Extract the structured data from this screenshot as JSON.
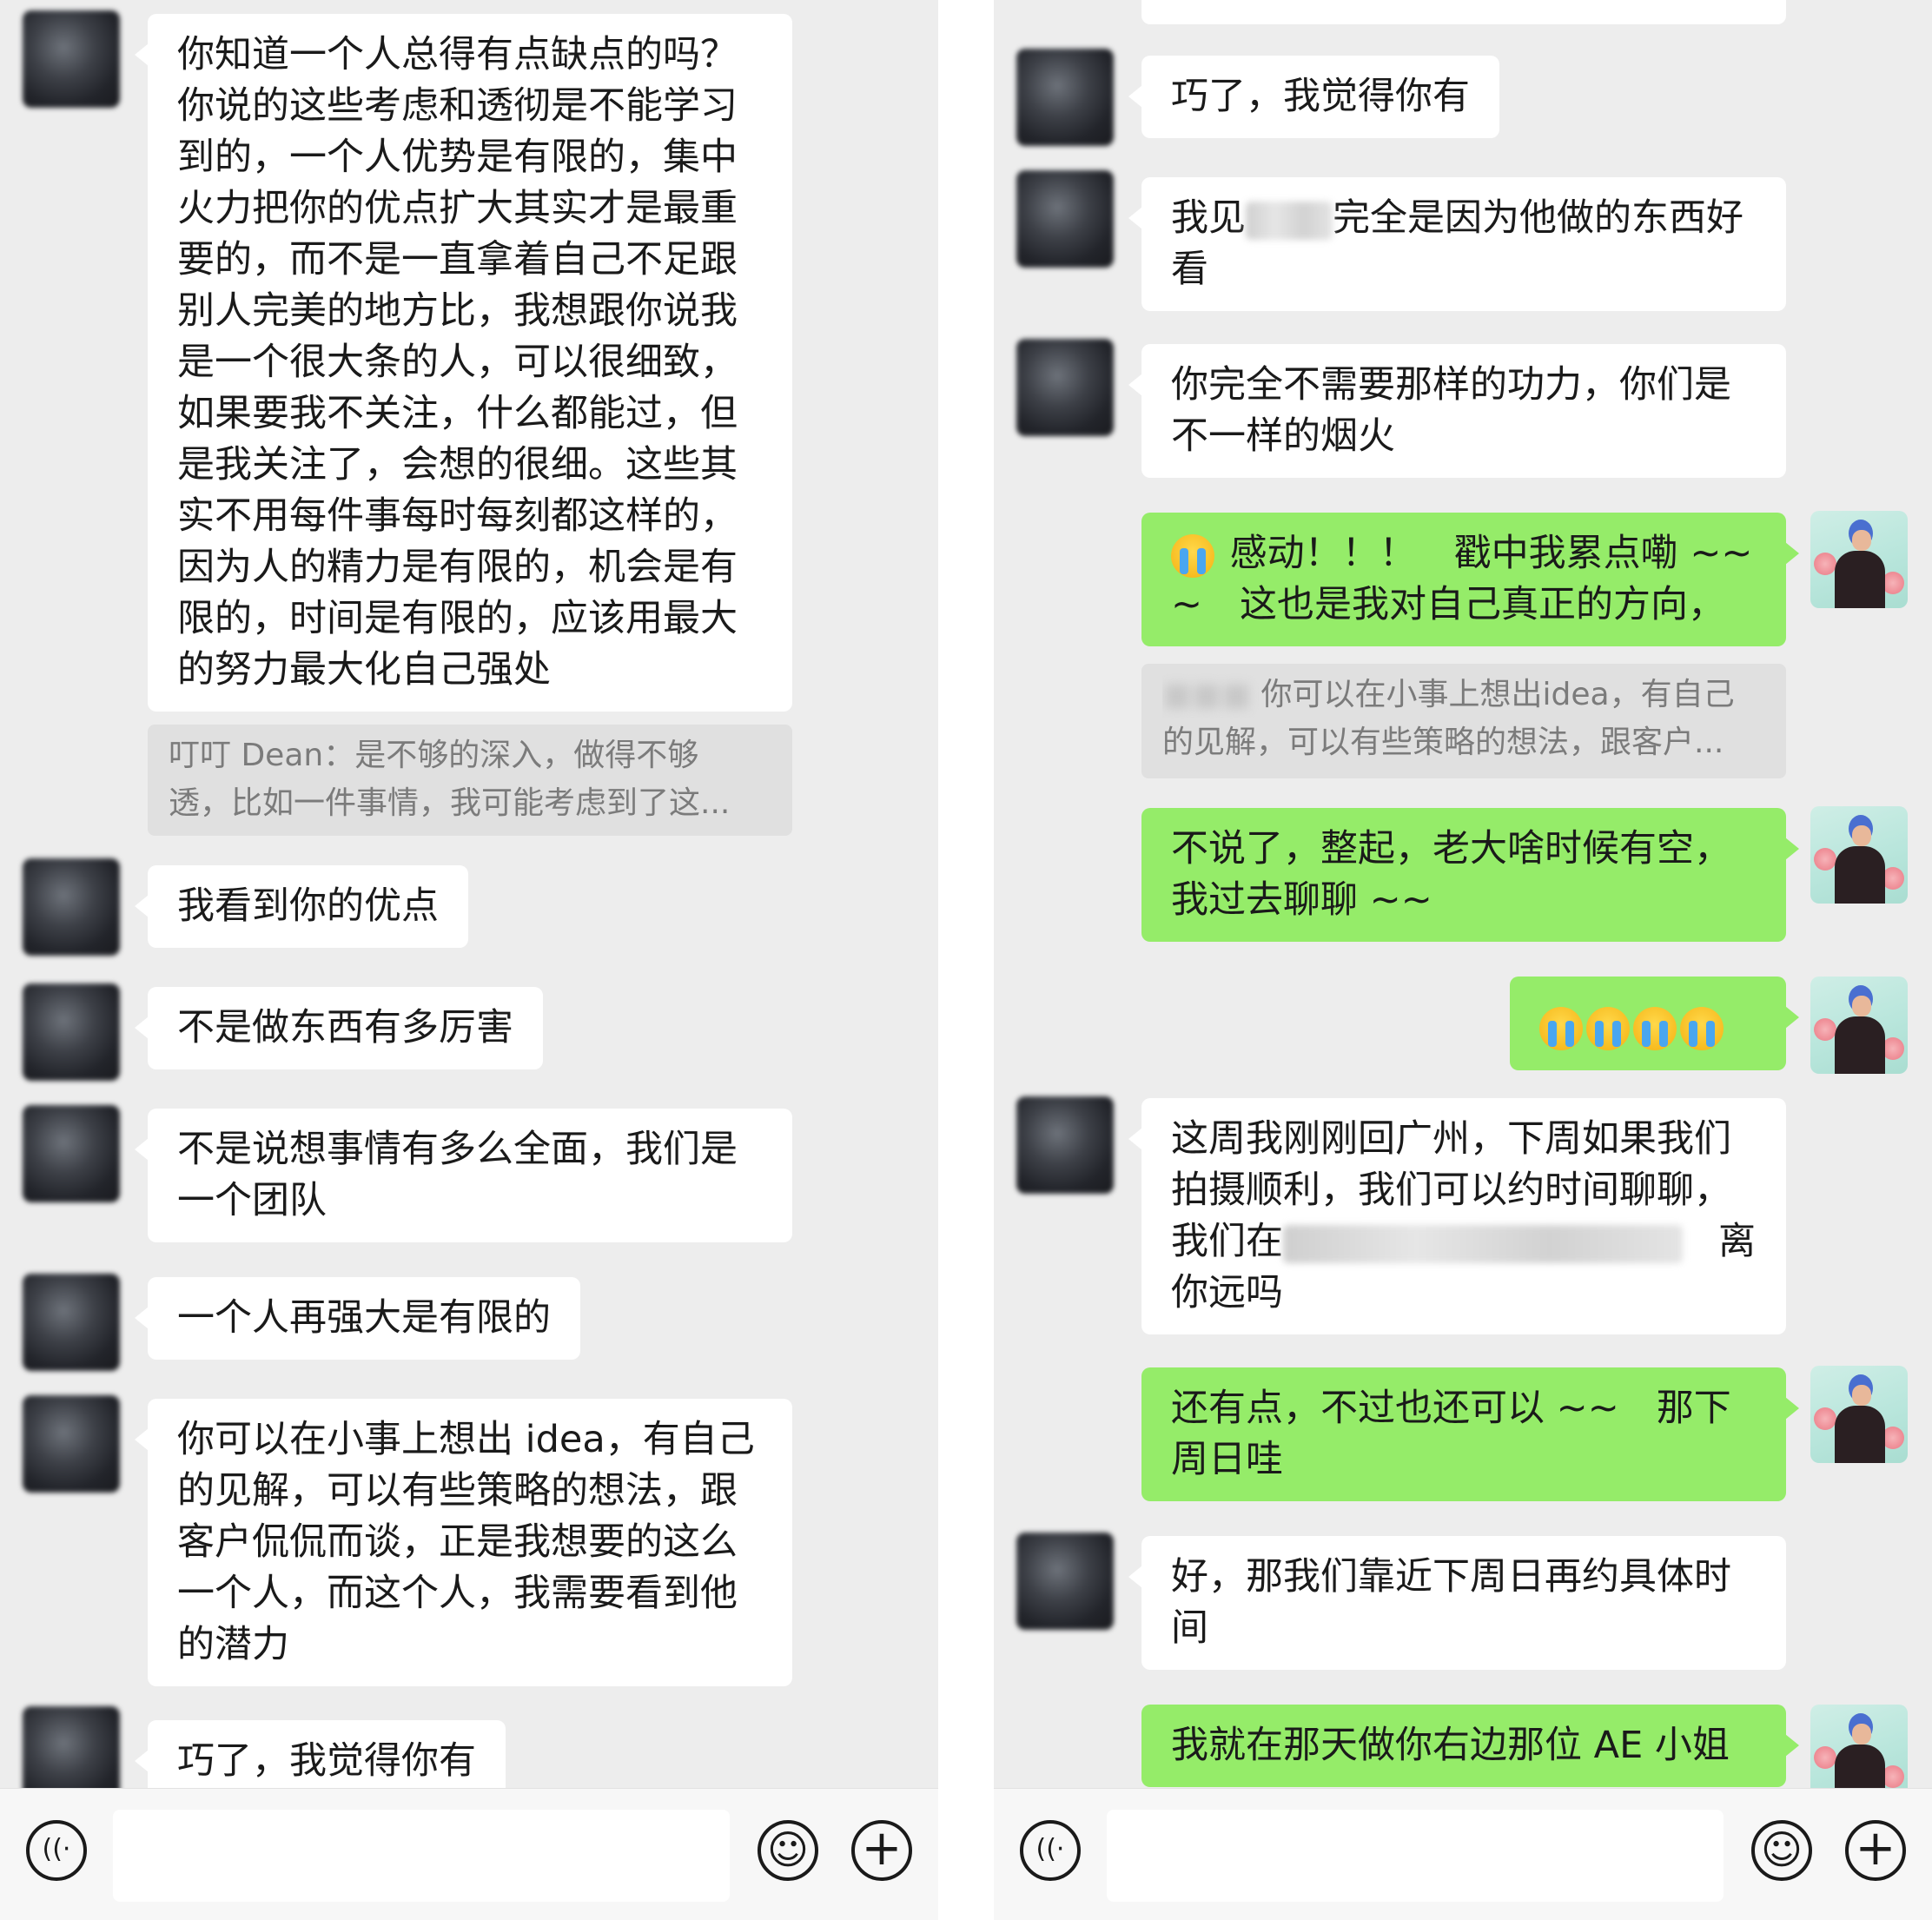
{
  "left_panel": {
    "messages": [
      {
        "text": "你知道一个人总得有点缺点的吗？你说的这些考虑和透彻是不能学习到的，一个人优势是有限的，集中火力把你的优点扩大其实才是最重要的，而不是一直拿着自己不足跟别人完美的地方比，我想跟你说我是一个很大条的人，可以很细致，如果要我不关注，什么都能过，但是我关注了，会想的很细。这些其实不用每件事每时每刻都这样的，因为人的精力是有限的，机会是有限的，时间是有限的，应该用最大的努力最大化自己强处"
      },
      {
        "quote_line1": "叮叮 Dean：是不够的深入，做得不够",
        "quote_line2": "透，比如一件事情，我可能考虑到了这..."
      },
      {
        "text": "我看到你的优点"
      },
      {
        "text": "不是做东西有多厉害"
      },
      {
        "text": "不是说想事情有多么全面，我们是一个团队"
      },
      {
        "text": "一个人再强大是有限的"
      },
      {
        "text": "你可以在小事上想出 idea，有自己的见解，可以有些策略的想法，跟客户侃侃而谈，正是我想要的这么一个人，而这个人，我需要看到他的潜力"
      },
      {
        "text": "巧了，我觉得你有"
      }
    ]
  },
  "right_panel": {
    "messages": [
      {
        "text": "巧了，我觉得你有"
      },
      {
        "text_a": "我见",
        "text_b": "完全是因为他做的东西好看"
      },
      {
        "text": "你完全不需要那样的功力，你们是不一样的烟火"
      },
      {
        "text": "感动！！！　戳中我累点嘞 ~~~　这也是我对自己真正的方向，"
      },
      {
        "quote_line1": "你可以在小事上想出idea，有自己",
        "quote_line2": "的见解，可以有些策略的想法，跟客户..."
      },
      {
        "text": "不说了，整起，老大啥时候有空，我过去聊聊 ~~"
      },
      {
        "emoji": "crying-emoji x4"
      },
      {
        "text_a": "这周我刚刚回广州，下周如果我们拍摄顺利，我们可以约时间聊聊，我们在",
        "text_b": "离你远吗"
      },
      {
        "text": "还有点，不过也还可以 ~~　那下周日哇"
      },
      {
        "text": "好，那我们靠近下周日再约具体时间"
      },
      {
        "text": "我就在那天做你右边那位 AE 小姐"
      }
    ]
  },
  "toolbar": {
    "voice_icon": "voice-icon",
    "emoji_icon": "emoji-icon",
    "plus_icon": "plus-icon"
  },
  "colors": {
    "background": "#ededed",
    "bubble_other": "#ffffff",
    "bubble_self": "#95ec69",
    "quote_bg": "#e0e0e0",
    "quote_text": "#7b7b7b"
  }
}
